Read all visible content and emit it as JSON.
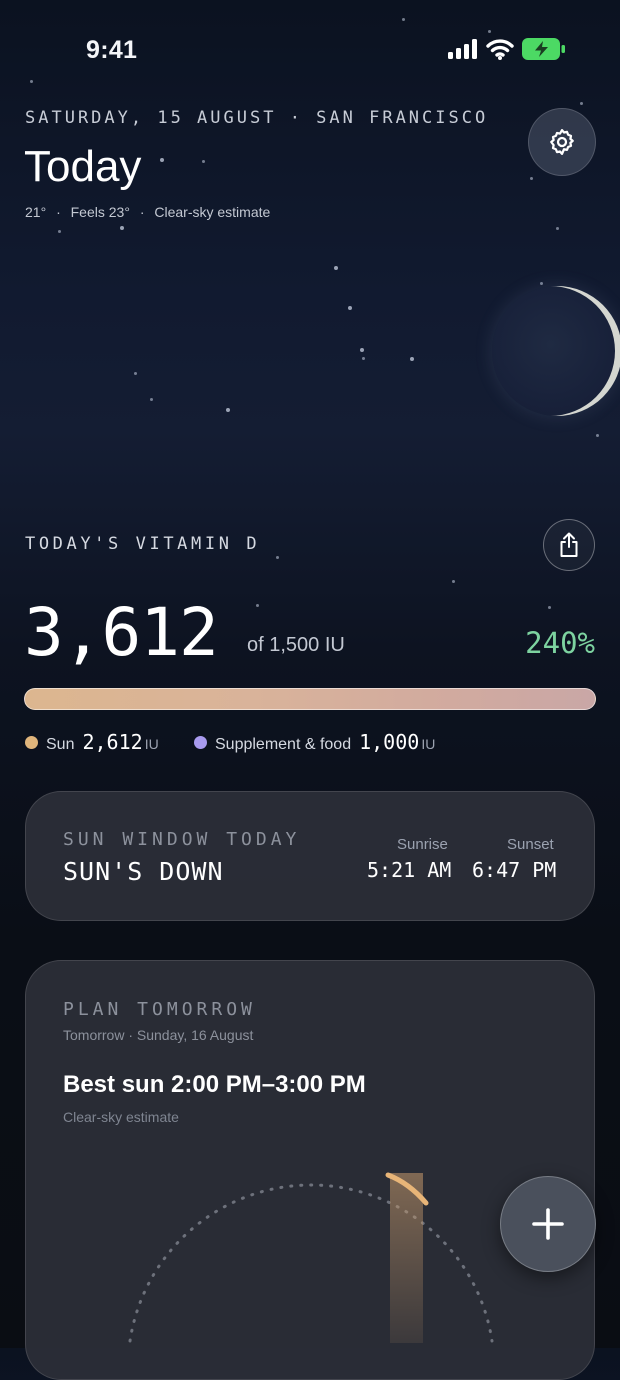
{
  "status_bar": {
    "time": "9:41"
  },
  "header": {
    "date_location": "SATURDAY, 15 AUGUST · SAN FRANCISCO",
    "title": "Today",
    "temp": "21°",
    "feels": "Feels 23°",
    "estimate": "Clear-sky estimate",
    "separator": "·"
  },
  "vitamin_d": {
    "title": "TODAY'S VITAMIN D",
    "value": "3,612",
    "goal": "of 1,500 IU",
    "percent": "240%",
    "progress_fraction": 1.0,
    "legend": [
      {
        "label": "Sun",
        "value": "2,612",
        "unit": "IU",
        "color": "#e0b57c"
      },
      {
        "label": "Supplement & food",
        "value": "1,000",
        "unit": "IU",
        "color": "#a99bef"
      }
    ]
  },
  "sun_window": {
    "label": "SUN WINDOW TODAY",
    "status": "SUN'S DOWN",
    "sunrise_label": "Sunrise",
    "sunrise": "5:21 AM",
    "sunset_label": "Sunset",
    "sunset": "6:47 PM"
  },
  "plan": {
    "label": "PLAN TOMORROW",
    "date": "Tomorrow · Sunday, 16 August",
    "best": "Best sun 2:00 PM–3:00 PM",
    "estimate": "Clear-sky estimate"
  },
  "icons": {
    "settings": "gear-icon",
    "share": "share-icon",
    "add": "plus-icon",
    "signal": "signal-icon",
    "wifi": "wifi-icon",
    "battery": "battery-icon"
  },
  "colors": {
    "accent_green": "#7dd3a0",
    "sun": "#e0b57c",
    "supplement": "#a99bef",
    "battery": "#4cd964"
  }
}
